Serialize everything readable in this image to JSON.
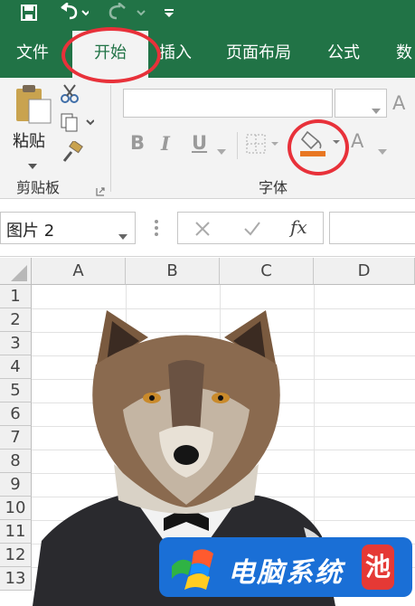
{
  "qat": {
    "icons": [
      "save-icon",
      "undo-icon",
      "redo-icon",
      "customize-qat-icon"
    ]
  },
  "tabs": [
    {
      "label": "文件"
    },
    {
      "label": "开始"
    },
    {
      "label": "插入"
    },
    {
      "label": "页面布局"
    },
    {
      "label": "公式"
    },
    {
      "label": "数"
    }
  ],
  "ribbon": {
    "clipboard": {
      "paste_label": "粘贴",
      "group_label": "剪贴板"
    },
    "font": {
      "group_label": "字体",
      "font_name": "",
      "font_size": "",
      "bold": "B",
      "italic": "I",
      "underline": "U",
      "font_color_letter": "A",
      "grow_font": "A"
    }
  },
  "formula_bar": {
    "name_box": "图片 2",
    "fx": "fx",
    "formula": ""
  },
  "sheet": {
    "columns": [
      "A",
      "B",
      "C",
      "D"
    ],
    "rows": [
      "1",
      "2",
      "3",
      "4",
      "5",
      "6",
      "7",
      "8",
      "9",
      "10",
      "11",
      "12",
      "13"
    ]
  },
  "watermark": {
    "text": "电脑系统",
    "badge": "池"
  },
  "colors": {
    "excel_green": "#217346",
    "ribbon_bg": "#f3f3f3",
    "highlight_ring": "#e8313a",
    "watermark_blue": "#1a6fd6",
    "fill_color_bar": "#e87722"
  }
}
